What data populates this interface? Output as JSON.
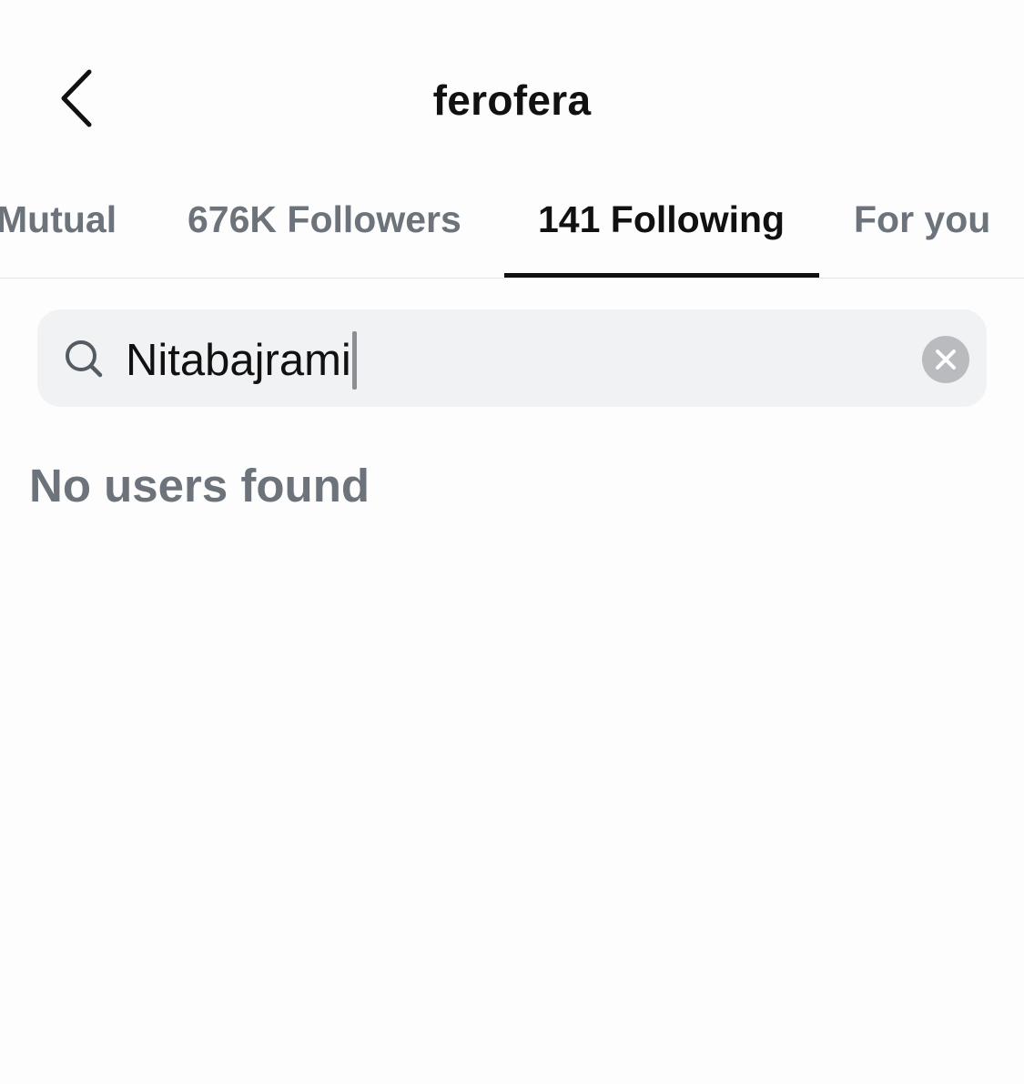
{
  "header": {
    "title": "ferofera",
    "back_icon": "chevron-left-icon"
  },
  "tabs": [
    {
      "label": "Mutual",
      "active": false
    },
    {
      "label": "676K Followers",
      "active": false
    },
    {
      "label": "141 Following",
      "active": true
    },
    {
      "label": "For you",
      "active": false
    }
  ],
  "search": {
    "value": "Nitabajrami",
    "icon": "search-icon",
    "clear_icon": "clear-icon"
  },
  "results": {
    "empty_message": "No users found"
  },
  "colors": {
    "background": "#fdfdfd",
    "text_primary": "#111111",
    "text_secondary": "#6d737b",
    "search_background": "#f1f2f4",
    "clear_button": "#b9bbbf"
  }
}
